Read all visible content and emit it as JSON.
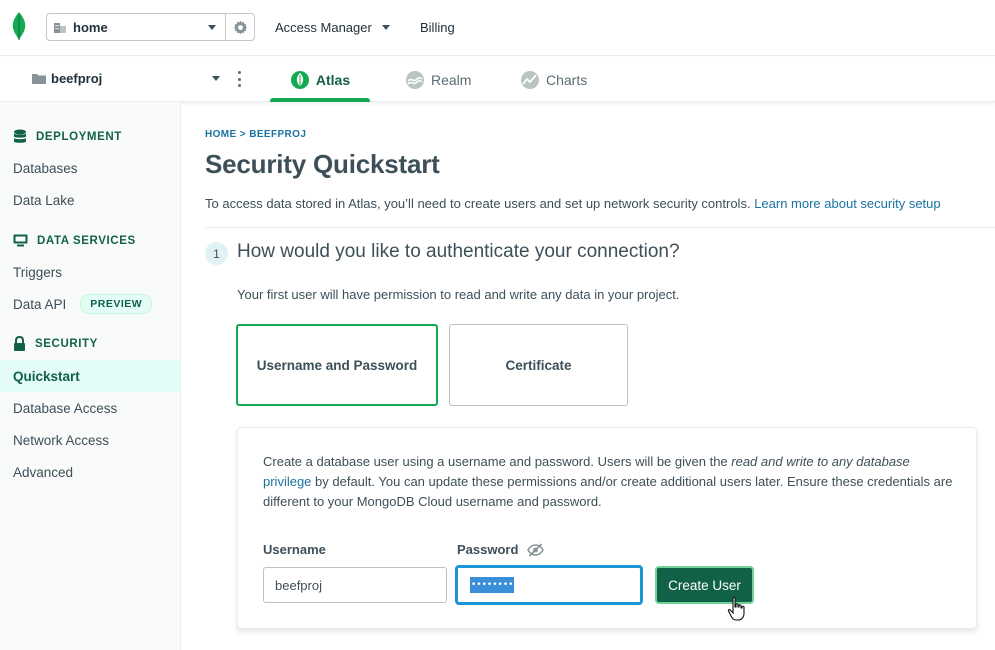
{
  "topbar": {
    "org_name": "home",
    "nav": [
      {
        "label": "Access Manager"
      },
      {
        "label": "Billing"
      }
    ]
  },
  "project_bar": {
    "project_name": "beefproj",
    "tabs": [
      {
        "label": "Atlas",
        "active": true
      },
      {
        "label": "Realm",
        "active": false
      },
      {
        "label": "Charts",
        "active": false
      }
    ]
  },
  "sidebar": {
    "sections": [
      {
        "title": "DEPLOYMENT",
        "icon": "database-icon",
        "items": [
          "Databases",
          "Data Lake"
        ]
      },
      {
        "title": "DATA SERVICES",
        "icon": "services-icon",
        "items": [
          "Triggers",
          "Data API"
        ]
      },
      {
        "title": "SECURITY",
        "icon": "lock-icon",
        "items": [
          "Quickstart",
          "Database Access",
          "Network Access",
          "Advanced"
        ]
      }
    ],
    "data_api_badge": "PREVIEW",
    "active_item": "Quickstart"
  },
  "main": {
    "breadcrumb": "HOME > BEEFPROJ",
    "title": "Security Quickstart",
    "intro_text": "To access data stored in Atlas, you’ll need to create users and set up network security controls. ",
    "intro_link": "Learn more about security setup",
    "step_number": "1",
    "step_question": "How would you like to authenticate your connection?",
    "step_subtext": "Your first user will have permission to read and write any data in your project.",
    "options": [
      {
        "label": "Username and Password",
        "selected": true
      },
      {
        "label": "Certificate",
        "selected": false
      }
    ],
    "card": {
      "text_1": "Create a database user using a username and password. Users will be given the ",
      "text_em": "read and write to any database",
      "text_link": "privilege",
      "text_2": " by default. You can update these permissions and/or create additional users later. Ensure these credentials are different to your MongoDB Cloud username and password.",
      "username_label": "Username",
      "username_value": "beefproj",
      "password_label": "Password",
      "password_mask": "••••••••",
      "create_button": "Create User"
    }
  },
  "colors": {
    "brand_green": "#13aa52",
    "dark_green": "#116149",
    "link_blue": "#1a73a0",
    "focus_blue": "#1c96d6"
  }
}
